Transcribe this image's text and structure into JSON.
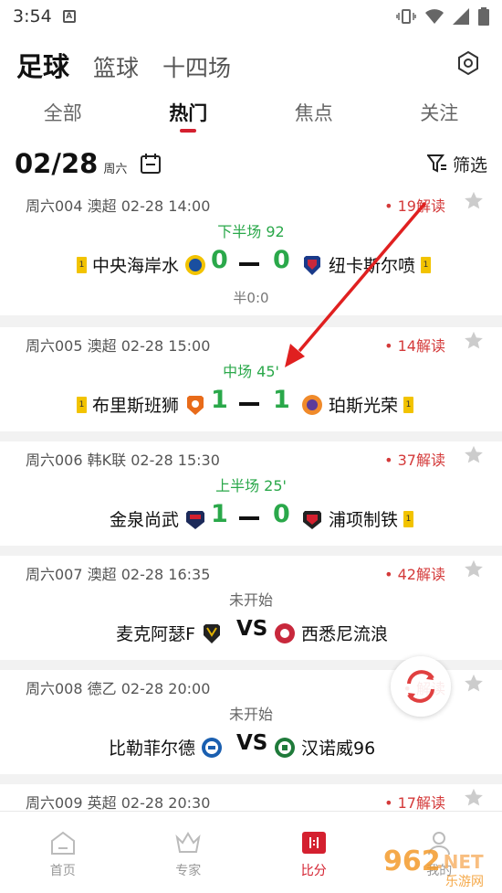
{
  "status_bar": {
    "time": "3:54"
  },
  "header": {
    "sport_tabs": [
      "足球",
      "篮球",
      "十四场"
    ],
    "sub_tabs": [
      "全部",
      "热门",
      "焦点",
      "关注"
    ]
  },
  "date_bar": {
    "date": "02/28",
    "weekday": "周六",
    "filter_label": "筛选"
  },
  "matches": [
    {
      "meta": "周六004 澳超 02-28 14:00",
      "reads": "19解读",
      "status": "下半场 92",
      "home": "中央海岸水",
      "home_yellow": "1",
      "home_score": "0",
      "away": "纽卡斯尔喷",
      "away_yellow": "1",
      "away_score": "0",
      "half": "半0:0"
    },
    {
      "meta": "周六005 澳超 02-28 15:00",
      "reads": "14解读",
      "status": "中场 45'",
      "home": "布里斯班狮",
      "home_yellow": "1",
      "home_score": "1",
      "away": "珀斯光荣",
      "away_yellow": "1",
      "away_score": "1"
    },
    {
      "meta": "周六006 韩K联 02-28 15:30",
      "reads": "37解读",
      "status": "上半场 25'",
      "home": "金泉尚武",
      "home_score": "1",
      "away": "浦项制铁",
      "away_yellow": "1",
      "away_score": "0"
    },
    {
      "meta": "周六007 澳超 02-28 16:35",
      "reads": "42解读",
      "status": "未开始",
      "home": "麦克阿瑟F",
      "vs": "VS",
      "away": "西悉尼流浪"
    },
    {
      "meta": "周六008 德乙 02-28 20:00",
      "reads": "解读",
      "status": "未开始",
      "home": "比勒菲尔德",
      "vs": "VS",
      "away": "汉诺威96"
    },
    {
      "meta": "周六009 英超 02-28 20:30",
      "reads": "17解读"
    }
  ],
  "tab_bar": {
    "items": [
      "首页",
      "专家",
      "比分",
      "我的"
    ]
  },
  "watermark": {
    "text_main": "962",
    "text_sub": ".NET",
    "text_cn": "乐游网"
  },
  "colors": {
    "accent": "#d4202f",
    "live": "#2aa84a",
    "reads": "#d43a3a"
  }
}
